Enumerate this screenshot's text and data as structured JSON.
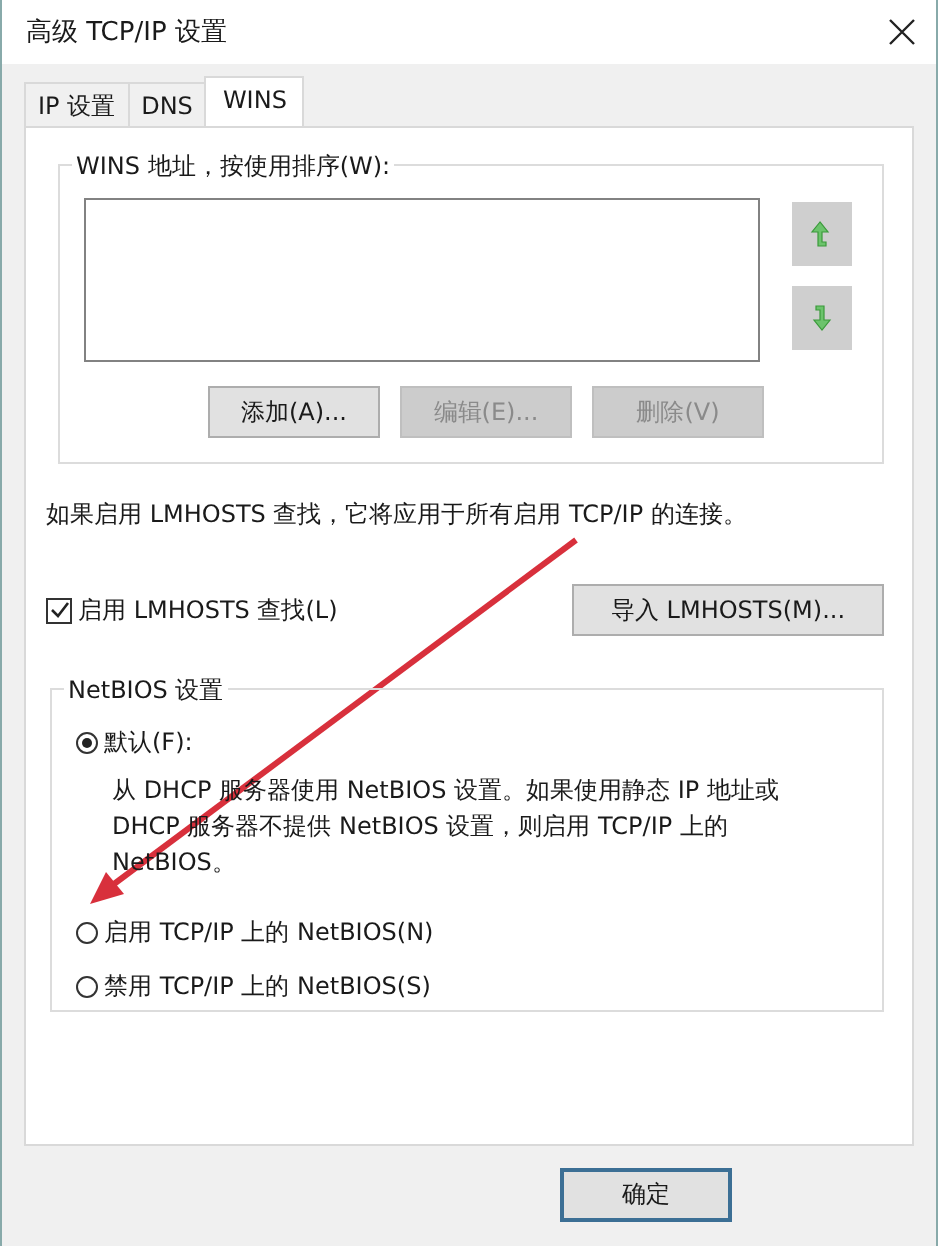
{
  "window": {
    "title": "高级 TCP/IP 设置"
  },
  "tabs": [
    {
      "label": "IP 设置",
      "selected": false
    },
    {
      "label": "DNS",
      "selected": false
    },
    {
      "label": "WINS",
      "selected": true
    }
  ],
  "wins_group": {
    "title": "WINS 地址，按使用排序(W):",
    "buttons": [
      {
        "label": "添加(A)...",
        "disabled": false
      },
      {
        "label": "编辑(E)...",
        "disabled": true
      },
      {
        "label": "删除(V)",
        "disabled": true
      }
    ]
  },
  "note": "如果启用 LMHOSTS 查找，它将应用于所有启用 TCP/IP 的连接。",
  "lmhosts_checkbox": {
    "label": "启用 LMHOSTS 查找(L)",
    "checked": true
  },
  "import_button": "导入 LMHOSTS(M)...",
  "netbios": {
    "title": "NetBIOS 设置",
    "options": [
      {
        "label": "默认(F):",
        "selected": true,
        "description": "从 DHCP 服务器使用 NetBIOS 设置。如果使用静态 IP 地址或 DHCP 服务器不提供 NetBIOS 设置，则启用 TCP/IP 上的 NetBIOS。"
      },
      {
        "label": "启用 TCP/IP 上的 NetBIOS(N)",
        "selected": false
      },
      {
        "label": "禁用 TCP/IP 上的 NetBIOS(S)",
        "selected": false
      }
    ]
  },
  "footer_buttons": [
    "确定"
  ]
}
